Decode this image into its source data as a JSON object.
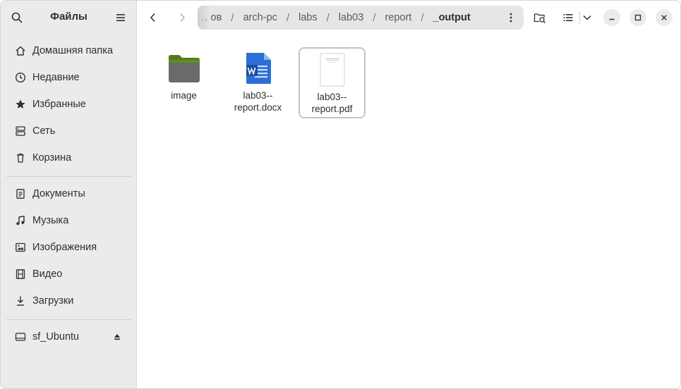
{
  "sidebar": {
    "title": "Файлы",
    "places": [
      {
        "label": "Домашняя папка",
        "icon": "home-icon"
      },
      {
        "label": "Недавние",
        "icon": "clock-icon"
      },
      {
        "label": "Избранные",
        "icon": "star-icon"
      },
      {
        "label": "Сеть",
        "icon": "network-icon"
      },
      {
        "label": "Корзина",
        "icon": "trash-icon"
      }
    ],
    "folders": [
      {
        "label": "Документы",
        "icon": "document-icon"
      },
      {
        "label": "Музыка",
        "icon": "music-icon"
      },
      {
        "label": "Изображения",
        "icon": "image-icon"
      },
      {
        "label": "Видео",
        "icon": "film-icon"
      },
      {
        "label": "Загрузки",
        "icon": "download-icon"
      }
    ],
    "devices": [
      {
        "label": "sf_Ubuntu",
        "icon": "drive-icon"
      }
    ]
  },
  "path": {
    "crumbs": [
      "… ов",
      "arch-pc",
      "labs",
      "lab03",
      "report",
      "_output"
    ],
    "separator": "/"
  },
  "files": [
    {
      "name": "image",
      "type": "folder",
      "selected": false
    },
    {
      "name": "lab03--report.docx",
      "type": "docx",
      "selected": false
    },
    {
      "name": "lab03--report.pdf",
      "type": "pdf",
      "selected": true
    }
  ],
  "colors": {
    "sidebar_bg": "#ebebeb",
    "path_bg": "#e6e6e6",
    "folder_green": "#5f8f1f",
    "word_blue": "#2b6fd6"
  }
}
